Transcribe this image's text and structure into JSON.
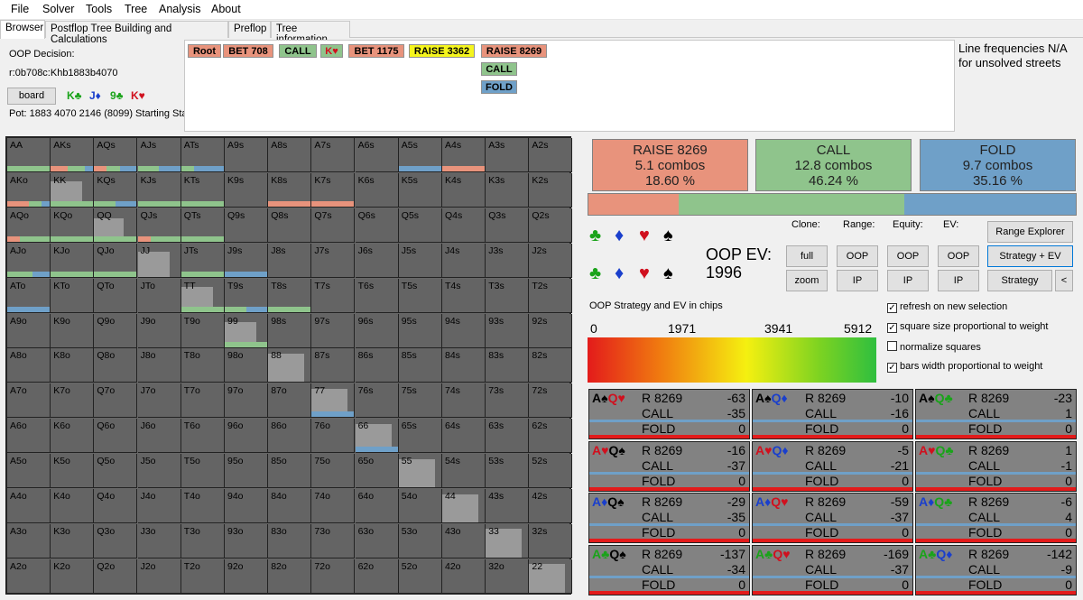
{
  "menu": [
    "File",
    "Solver",
    "Tools",
    "Tree",
    "Analysis",
    "About"
  ],
  "tabs": [
    "Browser",
    "Postflop Tree Building and Calculations",
    "Preflop",
    "Tree information"
  ],
  "decision": {
    "title": "OOP Decision:",
    "path": "r:0b708c:Khb1883b4070",
    "board_label": "board",
    "board_cards": [
      {
        "rank": "K",
        "suit": "♣",
        "color": "#1aa31a"
      },
      {
        "rank": "J",
        "suit": "♦",
        "color": "#1a3fcc"
      },
      {
        "rank": "9",
        "suit": "♣",
        "color": "#1aa31a"
      },
      {
        "rank": "K",
        "suit": "♥",
        "color": "#d0101e"
      }
    ],
    "pot": "Pot: 1883 4070 2146 (8099) Starting Sta"
  },
  "tree": {
    "nodes": [
      {
        "label": "Root",
        "color": "#e8937c"
      },
      {
        "label": "BET 708",
        "color": "#e8937c"
      },
      {
        "label": "CALL",
        "color": "#8fc48c"
      },
      {
        "label": "K♥",
        "color": "#8fc48c"
      },
      {
        "label": "BET 1175",
        "color": "#e8937c"
      },
      {
        "label": "RAISE 3362",
        "color": "#f5f51e"
      },
      {
        "label": "RAISE 8269",
        "color": "#e8937c"
      }
    ],
    "children": [
      {
        "label": "CALL",
        "color": "#8fc48c"
      },
      {
        "label": "FOLD",
        "color": "#6fa0c8"
      }
    ]
  },
  "line_freq": "Line frequencies N/A for unsolved streets",
  "grid": [
    [
      "AA",
      "AKs",
      "AQs",
      "AJs",
      "ATs",
      "A9s",
      "A8s",
      "A7s",
      "A6s",
      "A5s",
      "A4s",
      "A3s",
      "A2s"
    ],
    [
      "AKo",
      "KK",
      "KQs",
      "KJs",
      "KTs",
      "K9s",
      "K8s",
      "K7s",
      "K6s",
      "K5s",
      "K4s",
      "K3s",
      "K2s"
    ],
    [
      "AQo",
      "KQo",
      "QQ",
      "QJs",
      "QTs",
      "Q9s",
      "Q8s",
      "Q7s",
      "Q6s",
      "Q5s",
      "Q4s",
      "Q3s",
      "Q2s"
    ],
    [
      "AJo",
      "KJo",
      "QJo",
      "JJ",
      "JTs",
      "J9s",
      "J8s",
      "J7s",
      "J6s",
      "J5s",
      "J4s",
      "J3s",
      "J2s"
    ],
    [
      "ATo",
      "KTo",
      "QTo",
      "JTo",
      "TT",
      "T9s",
      "T8s",
      "T7s",
      "T6s",
      "T5s",
      "T4s",
      "T3s",
      "T2s"
    ],
    [
      "A9o",
      "K9o",
      "Q9o",
      "J9o",
      "T9o",
      "99",
      "98s",
      "97s",
      "96s",
      "95s",
      "94s",
      "93s",
      "92s"
    ],
    [
      "A8o",
      "K8o",
      "Q8o",
      "J8o",
      "T8o",
      "98o",
      "88",
      "87s",
      "86s",
      "85s",
      "84s",
      "83s",
      "82s"
    ],
    [
      "A7o",
      "K7o",
      "Q7o",
      "J7o",
      "T7o",
      "97o",
      "87o",
      "77",
      "76s",
      "75s",
      "74s",
      "73s",
      "72s"
    ],
    [
      "A6o",
      "K6o",
      "Q6o",
      "J6o",
      "T6o",
      "96o",
      "86o",
      "76o",
      "66",
      "65s",
      "64s",
      "63s",
      "62s"
    ],
    [
      "A5o",
      "K5o",
      "Q5o",
      "J5o",
      "T5o",
      "95o",
      "85o",
      "75o",
      "65o",
      "55",
      "54s",
      "53s",
      "52s"
    ],
    [
      "A4o",
      "K4o",
      "Q4o",
      "J4o",
      "T4o",
      "94o",
      "84o",
      "74o",
      "64o",
      "54o",
      "44",
      "43s",
      "42s"
    ],
    [
      "A3o",
      "K3o",
      "Q3o",
      "J3o",
      "T3o",
      "93o",
      "83o",
      "73o",
      "63o",
      "53o",
      "43o",
      "33",
      "32s"
    ],
    [
      "A2o",
      "K2o",
      "Q2o",
      "J2o",
      "T2o",
      "92o",
      "82o",
      "72o",
      "62o",
      "52o",
      "42o",
      "32o",
      "22"
    ]
  ],
  "summary": [
    {
      "action": "RAISE 8269",
      "combos": "5.1 combos",
      "pct": "18.60 %",
      "share": 0.186,
      "color": "#e8937c"
    },
    {
      "action": "CALL",
      "combos": "12.8 combos",
      "pct": "46.24 %",
      "share": 0.4624,
      "color": "#8fc48c"
    },
    {
      "action": "FOLD",
      "combos": "9.7 combos",
      "pct": "35.16 %",
      "share": 0.3516,
      "color": "#6fa0c8"
    }
  ],
  "controls": {
    "col_labels": [
      "Clone:",
      "Range:",
      "Equity:",
      "EV:"
    ],
    "oop_ev": "OOP EV:",
    "oop_ev_value": "1996",
    "full": "full",
    "zoom": "zoom",
    "oop": "OOP",
    "ip": "IP",
    "range_explorer": "Range Explorer",
    "strategy_ev": "Strategy + EV",
    "strategy": "Strategy",
    "back": "<"
  },
  "legend": {
    "title": "OOP Strategy and EV in chips",
    "ticks": [
      "0",
      "1971",
      "3941",
      "5912"
    ]
  },
  "checkboxes": [
    {
      "label": "refresh on new selection",
      "checked": true
    },
    {
      "label": "square size proportional to weight",
      "checked": true
    },
    {
      "label": "normalize squares",
      "checked": false
    },
    {
      "label": "bars width proportional to weight",
      "checked": true
    }
  ],
  "hands": [
    {
      "cards": [
        {
          "t": "A♠",
          "c": "#000"
        },
        {
          "t": "Q♥",
          "c": "#d0101e"
        }
      ],
      "r": "R 8269",
      "rv": "-63",
      "c": "CALL",
      "cv": "-35",
      "f": "FOLD",
      "fv": "0"
    },
    {
      "cards": [
        {
          "t": "A♠",
          "c": "#000"
        },
        {
          "t": "Q♦",
          "c": "#1a3fcc"
        }
      ],
      "r": "R 8269",
      "rv": "-10",
      "c": "CALL",
      "cv": "-16",
      "f": "FOLD",
      "fv": "0"
    },
    {
      "cards": [
        {
          "t": "A♠",
          "c": "#000"
        },
        {
          "t": "Q♣",
          "c": "#1aa31a"
        }
      ],
      "r": "R 8269",
      "rv": "-23",
      "c": "CALL",
      "cv": "1",
      "f": "FOLD",
      "fv": "0"
    },
    {
      "cards": [
        {
          "t": "A♥",
          "c": "#d0101e"
        },
        {
          "t": "Q♠",
          "c": "#000"
        }
      ],
      "r": "R 8269",
      "rv": "-16",
      "c": "CALL",
      "cv": "-37",
      "f": "FOLD",
      "fv": "0"
    },
    {
      "cards": [
        {
          "t": "A♥",
          "c": "#d0101e"
        },
        {
          "t": "Q♦",
          "c": "#1a3fcc"
        }
      ],
      "r": "R 8269",
      "rv": "-5",
      "c": "CALL",
      "cv": "-21",
      "f": "FOLD",
      "fv": "0"
    },
    {
      "cards": [
        {
          "t": "A♥",
          "c": "#d0101e"
        },
        {
          "t": "Q♣",
          "c": "#1aa31a"
        }
      ],
      "r": "R 8269",
      "rv": "1",
      "c": "CALL",
      "cv": "-1",
      "f": "FOLD",
      "fv": "0"
    },
    {
      "cards": [
        {
          "t": "A♦",
          "c": "#1a3fcc"
        },
        {
          "t": "Q♠",
          "c": "#000"
        }
      ],
      "r": "R 8269",
      "rv": "-29",
      "c": "CALL",
      "cv": "-35",
      "f": "FOLD",
      "fv": "0"
    },
    {
      "cards": [
        {
          "t": "A♦",
          "c": "#1a3fcc"
        },
        {
          "t": "Q♥",
          "c": "#d0101e"
        }
      ],
      "r": "R 8269",
      "rv": "-59",
      "c": "CALL",
      "cv": "-37",
      "f": "FOLD",
      "fv": "0"
    },
    {
      "cards": [
        {
          "t": "A♦",
          "c": "#1a3fcc"
        },
        {
          "t": "Q♣",
          "c": "#1aa31a"
        }
      ],
      "r": "R 8269",
      "rv": "-6",
      "c": "CALL",
      "cv": "4",
      "f": "FOLD",
      "fv": "0"
    },
    {
      "cards": [
        {
          "t": "A♣",
          "c": "#1aa31a"
        },
        {
          "t": "Q♠",
          "c": "#000"
        }
      ],
      "r": "R 8269",
      "rv": "-137",
      "c": "CALL",
      "cv": "-34",
      "f": "FOLD",
      "fv": "0"
    },
    {
      "cards": [
        {
          "t": "A♣",
          "c": "#1aa31a"
        },
        {
          "t": "Q♥",
          "c": "#d0101e"
        }
      ],
      "r": "R 8269",
      "rv": "-169",
      "c": "CALL",
      "cv": "-37",
      "f": "FOLD",
      "fv": "0"
    },
    {
      "cards": [
        {
          "t": "A♣",
          "c": "#1aa31a"
        },
        {
          "t": "Q♦",
          "c": "#1a3fcc"
        }
      ],
      "r": "R 8269",
      "rv": "-142",
      "c": "CALL",
      "cv": "-9",
      "f": "FOLD",
      "fv": "0"
    }
  ]
}
